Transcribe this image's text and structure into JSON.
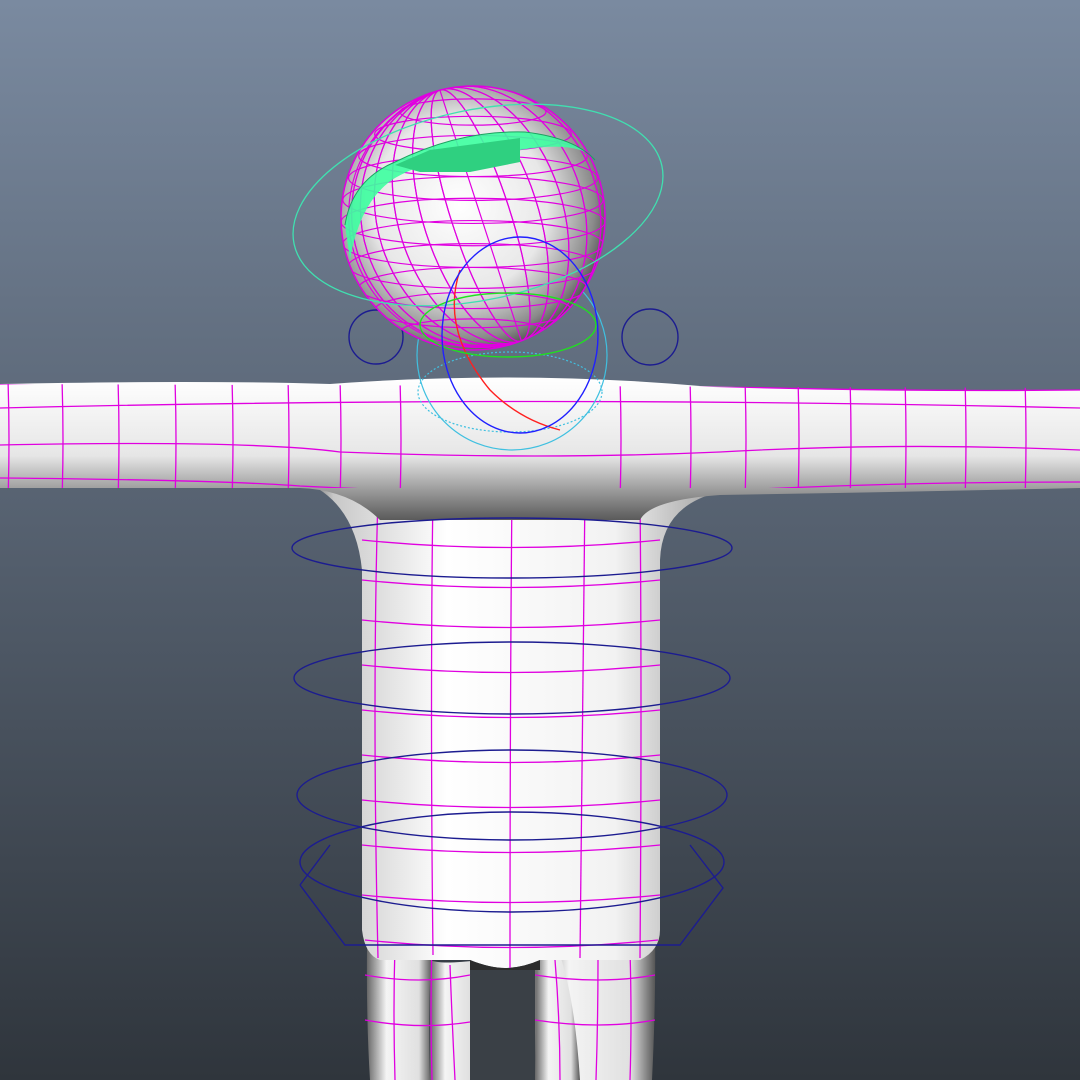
{
  "viewport": {
    "background_top": "#7a8aa0",
    "background_bottom": "#2f353c"
  },
  "model": {
    "surface_light": "#ffffff",
    "surface_shadow": "#444444",
    "wireframe_color": "#e000e0",
    "hair_color": "#3dffa0"
  },
  "rig_controls": {
    "head_rotate_color": "#40e0b0",
    "spine_ring_color": "#1c1c90",
    "shoulder_ring_color": "#1c1c90",
    "neck_ring_color": "#40c0e0",
    "manipulator_x_color": "#ff2020",
    "manipulator_y_color": "#20e020",
    "manipulator_z_color": "#2020ff"
  }
}
